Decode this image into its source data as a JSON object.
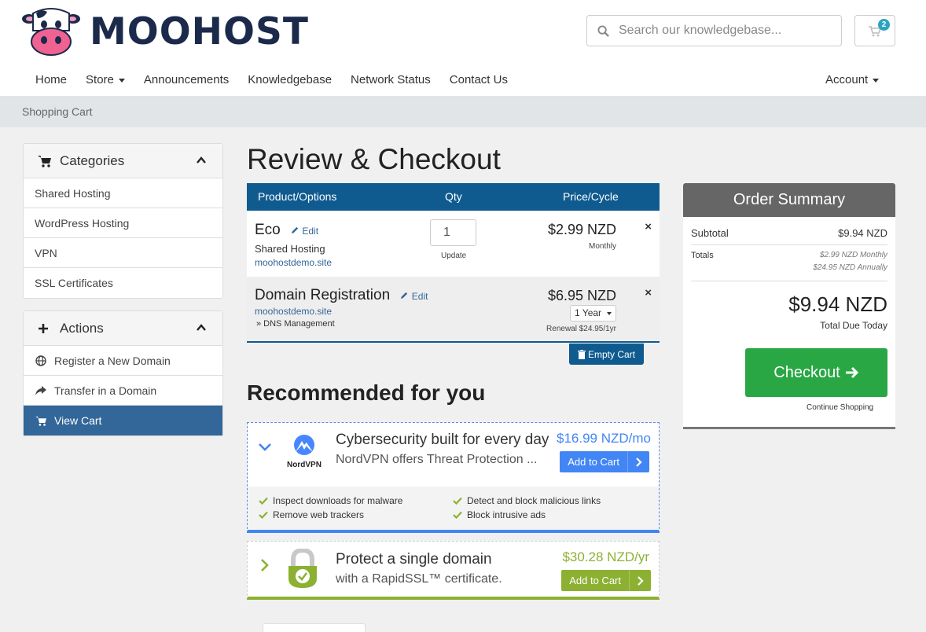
{
  "brand": {
    "name": "MOOHOST"
  },
  "search": {
    "placeholder": "Search our knowledgebase..."
  },
  "cart": {
    "count": "2"
  },
  "nav": {
    "items": [
      "Home",
      "Store",
      "Announcements",
      "Knowledgebase",
      "Network Status",
      "Contact Us"
    ],
    "account": "Account"
  },
  "breadcrumb": "Shopping Cart",
  "sidebar": {
    "categories": {
      "title": "Categories",
      "items": [
        "Shared Hosting",
        "WordPress Hosting",
        "VPN",
        "SSL Certificates"
      ]
    },
    "actions": {
      "title": "Actions",
      "items": [
        "Register a New Domain",
        "Transfer in a Domain",
        "View Cart"
      ]
    }
  },
  "page_title": "Review & Checkout",
  "table": {
    "headers": {
      "product": "Product/Options",
      "qty": "Qty",
      "price": "Price/Cycle"
    },
    "rows": [
      {
        "name": "Eco",
        "edit": "Edit",
        "group": "Shared Hosting",
        "domain": "moohostdemo.site",
        "qty": "1",
        "update": "Update",
        "price": "$2.99 NZD",
        "cycle": "Monthly"
      },
      {
        "name": "Domain Registration",
        "edit": "Edit",
        "domain": "moohostdemo.site",
        "addon": "» DNS Management",
        "price": "$6.95 NZD",
        "term": "1 Year",
        "renewal": "Renewal $24.95/1yr"
      }
    ],
    "empty_cart": "Empty Cart",
    "remove": "×"
  },
  "recommended": {
    "title": "Recommended for you",
    "items": [
      {
        "logo": "NordVPN",
        "headline": "Cybersecurity built for every day",
        "desc": "NordVPN offers Threat Protection ...",
        "price": "$16.99 NZD/mo",
        "button": "Add to Cart",
        "features": [
          "Inspect downloads for malware",
          "Detect and block malicious links",
          "Remove web trackers",
          "Block intrusive ads"
        ]
      },
      {
        "headline": "Protect a single domain",
        "desc": "with a RapidSSL™ certificate.",
        "price": "$30.28 NZD/yr",
        "button": "Add to Cart"
      }
    ]
  },
  "summary": {
    "title": "Order Summary",
    "subtotal_label": "Subtotal",
    "subtotal": "$9.94 NZD",
    "totals_label": "Totals",
    "totals_monthly": "$2.99 NZD Monthly",
    "totals_annually": "$24.95 NZD Annually",
    "total": "$9.94 NZD",
    "total_label": "Total Due Today",
    "checkout": "Checkout",
    "continue": "Continue Shopping"
  },
  "colors": {
    "brand_navy": "#1b2a4a",
    "table_header": "#0f5b8f",
    "active_item": "#336699",
    "checkout_green": "#29a744",
    "nord_blue": "#4285f4",
    "ssl_green": "#8cb132"
  }
}
